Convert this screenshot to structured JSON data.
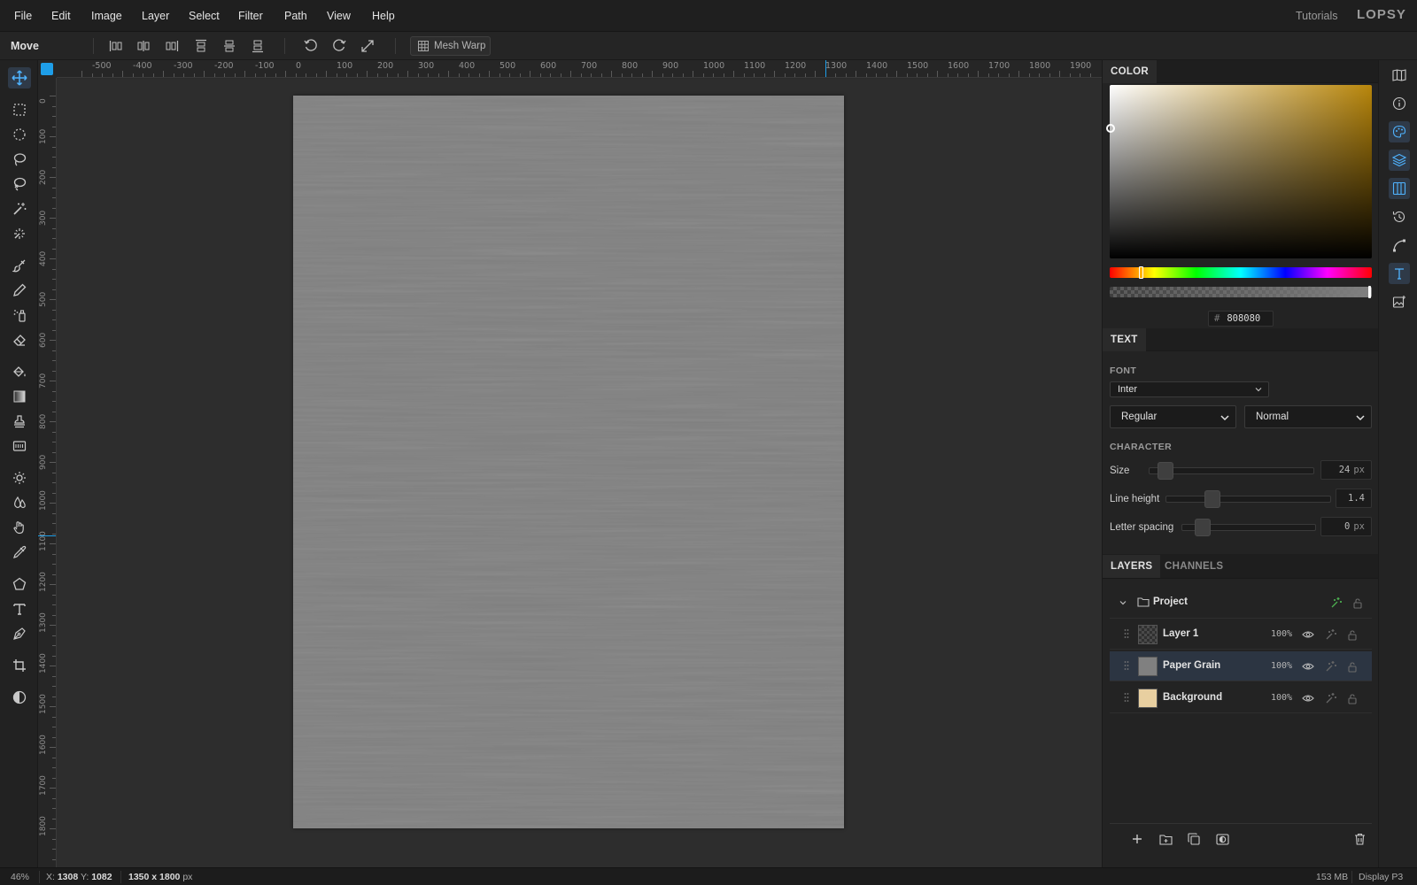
{
  "app": {
    "logo": "LOPSY",
    "tutorials_label": "Tutorials",
    "menu": [
      "File",
      "Edit",
      "Image",
      "Layer",
      "Select",
      "Filter",
      "Path",
      "View",
      "Help"
    ]
  },
  "options_bar": {
    "tool_name": "Move",
    "mesh_warp_label": "Mesh Warp"
  },
  "rulers": {
    "top_labels": [
      "-500",
      "-400",
      "-300",
      "-200",
      "-100",
      "0",
      "100",
      "200",
      "300",
      "400",
      "500",
      "600",
      "700",
      "800",
      "900",
      "1000",
      "1100",
      "1200",
      "1300",
      "1400",
      "1500",
      "1600",
      "1700",
      "1800",
      "1900"
    ],
    "left_labels": [
      "0",
      "100",
      "200",
      "300",
      "400",
      "500",
      "600",
      "700",
      "800",
      "900",
      "1000",
      "1100",
      "1200",
      "1300",
      "1400",
      "1500",
      "1600",
      "1700",
      "1800"
    ]
  },
  "color_panel": {
    "tab_label": "COLOR",
    "hex_prefix": "#",
    "hex_value": "808080",
    "hue_color": "#b8860b"
  },
  "text_panel": {
    "tab_label": "TEXT",
    "font_section": "FONT",
    "font_family": "Inter",
    "font_weight": "Regular",
    "font_style": "Normal",
    "character_section": "CHARACTER",
    "size": {
      "label": "Size",
      "value": "24",
      "unit": "px"
    },
    "line_height": {
      "label": "Line height",
      "value": "1.4"
    },
    "letter_spacing": {
      "label": "Letter spacing",
      "value": "0",
      "unit": "px"
    }
  },
  "layers_panel": {
    "tabs": [
      "LAYERS",
      "CHANNELS"
    ],
    "group_name": "Project",
    "layers": [
      {
        "name": "Layer 1",
        "opacity": "100%",
        "thumb": "transparent"
      },
      {
        "name": "Paper Grain",
        "opacity": "100%",
        "thumb": "#808080",
        "selected": true
      },
      {
        "name": "Background",
        "opacity": "100%",
        "thumb": "#e8cfa0"
      }
    ]
  },
  "status_bar": {
    "zoom": "46%",
    "x_label": "X:",
    "x_value": "1308",
    "y_label": "Y:",
    "y_value": "1082",
    "doc_size": "1350 x 1800",
    "doc_unit": "px",
    "memory": "153 MB",
    "color_profile": "Display P3"
  },
  "colors": {
    "accent": "#1e9ee8",
    "canvas_fill": "#808080",
    "selected_row": "#2c3542",
    "green_icon": "#4caf50"
  }
}
